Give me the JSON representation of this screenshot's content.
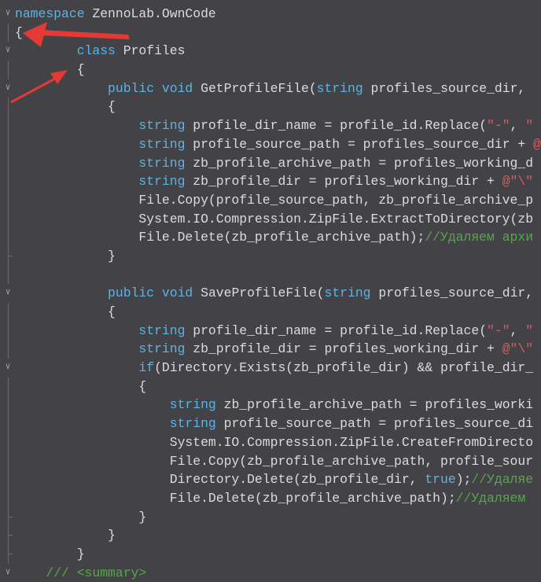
{
  "editor": {
    "lines": [
      {
        "indent": 0,
        "fold": "open",
        "tokens": [
          [
            "k",
            "namespace"
          ],
          [
            "t",
            " ZennoLab.OwnCode"
          ]
        ]
      },
      {
        "indent": 0,
        "tokens": [
          [
            "t",
            "{"
          ]
        ]
      },
      {
        "indent": 8,
        "fold": "open",
        "tokens": [
          [
            "k",
            "class"
          ],
          [
            "t",
            " Profiles"
          ]
        ]
      },
      {
        "indent": 8,
        "tokens": [
          [
            "t",
            "{"
          ]
        ]
      },
      {
        "indent": 12,
        "fold": "open",
        "tokens": [
          [
            "k",
            "public"
          ],
          [
            "t",
            " "
          ],
          [
            "k",
            "void"
          ],
          [
            "t",
            " GetProfileFile("
          ],
          [
            "k",
            "string"
          ],
          [
            "t",
            " profiles_source_dir,"
          ]
        ]
      },
      {
        "indent": 12,
        "tokens": [
          [
            "t",
            "{"
          ]
        ]
      },
      {
        "indent": 16,
        "tokens": [
          [
            "k",
            "string"
          ],
          [
            "t",
            " profile_dir_name = profile_id.Replace("
          ],
          [
            "s",
            "\"-\""
          ],
          [
            "t",
            ", "
          ],
          [
            "s",
            "\""
          ]
        ]
      },
      {
        "indent": 16,
        "tokens": [
          [
            "k",
            "string"
          ],
          [
            "t",
            " profile_source_path = profiles_source_dir + "
          ],
          [
            "s",
            "@"
          ]
        ]
      },
      {
        "indent": 16,
        "tokens": [
          [
            "k",
            "string"
          ],
          [
            "t",
            " zb_profile_archive_path = profiles_working_d"
          ]
        ]
      },
      {
        "indent": 16,
        "tokens": [
          [
            "k",
            "string"
          ],
          [
            "t",
            " zb_profile_dir = profiles_working_dir + "
          ],
          [
            "s",
            "@\"\\\""
          ]
        ]
      },
      {
        "indent": 16,
        "tokens": [
          [
            "t",
            "File.Copy(profile_source_path, zb_profile_archive_p"
          ]
        ]
      },
      {
        "indent": 16,
        "tokens": [
          [
            "t",
            "System.IO.Compression.ZipFile.ExtractToDirectory(zb"
          ]
        ]
      },
      {
        "indent": 16,
        "tokens": [
          [
            "t",
            "File.Delete(zb_profile_archive_path);"
          ],
          [
            "c",
            "//Удаляем архи"
          ]
        ]
      },
      {
        "indent": 12,
        "end": true,
        "tokens": [
          [
            "t",
            "}"
          ]
        ]
      },
      {
        "indent": 0,
        "tokens": []
      },
      {
        "indent": 12,
        "fold": "open",
        "tokens": [
          [
            "k",
            "public"
          ],
          [
            "t",
            " "
          ],
          [
            "k",
            "void"
          ],
          [
            "t",
            " SaveProfileFile("
          ],
          [
            "k",
            "string"
          ],
          [
            "t",
            " profiles_source_dir,"
          ]
        ]
      },
      {
        "indent": 12,
        "tokens": [
          [
            "t",
            "{"
          ]
        ]
      },
      {
        "indent": 16,
        "tokens": [
          [
            "k",
            "string"
          ],
          [
            "t",
            " profile_dir_name = profile_id.Replace("
          ],
          [
            "s",
            "\"-\""
          ],
          [
            "t",
            ", "
          ],
          [
            "s",
            "\""
          ]
        ]
      },
      {
        "indent": 16,
        "tokens": [
          [
            "k",
            "string"
          ],
          [
            "t",
            " zb_profile_dir = profiles_working_dir + "
          ],
          [
            "s",
            "@\"\\\""
          ]
        ]
      },
      {
        "indent": 16,
        "fold": "open",
        "tokens": [
          [
            "k",
            "if"
          ],
          [
            "t",
            "(Directory.Exists(zb_profile_dir) && profile_dir_"
          ]
        ]
      },
      {
        "indent": 16,
        "tokens": [
          [
            "t",
            "{"
          ]
        ]
      },
      {
        "indent": 20,
        "tokens": [
          [
            "k",
            "string"
          ],
          [
            "t",
            " zb_profile_archive_path = profiles_worki"
          ]
        ]
      },
      {
        "indent": 20,
        "tokens": [
          [
            "k",
            "string"
          ],
          [
            "t",
            " profile_source_path = profiles_source_di"
          ]
        ]
      },
      {
        "indent": 20,
        "tokens": [
          [
            "t",
            "System.IO.Compression.ZipFile.CreateFromDirecto"
          ]
        ]
      },
      {
        "indent": 20,
        "tokens": [
          [
            "t",
            "File.Copy(zb_profile_archive_path, profile_sour"
          ]
        ]
      },
      {
        "indent": 20,
        "tokens": [
          [
            "t",
            "Directory.Delete(zb_profile_dir, "
          ],
          [
            "k",
            "true"
          ],
          [
            "t",
            ");"
          ],
          [
            "c",
            "//Удаляе"
          ]
        ]
      },
      {
        "indent": 20,
        "tokens": [
          [
            "t",
            "File.Delete(zb_profile_archive_path);"
          ],
          [
            "c",
            "//Удаляем"
          ]
        ]
      },
      {
        "indent": 16,
        "end": true,
        "tokens": [
          [
            "t",
            "}"
          ]
        ]
      },
      {
        "indent": 12,
        "end": true,
        "tokens": [
          [
            "t",
            "}"
          ]
        ]
      },
      {
        "indent": 8,
        "end": true,
        "tokens": [
          [
            "t",
            "}"
          ]
        ]
      },
      {
        "indent": 4,
        "fold": "open",
        "tokens": [
          [
            "c",
            "/// <summary>"
          ]
        ]
      }
    ]
  },
  "colors": {
    "background": "#434347",
    "keyword": "#5ab4e6",
    "string": "#e05a5a",
    "comment": "#57a64a",
    "text": "#dcdcdc",
    "arrow": "#e53935"
  },
  "icons": {
    "fold": "chevron-down-icon",
    "annotation": "arrow-icon"
  }
}
